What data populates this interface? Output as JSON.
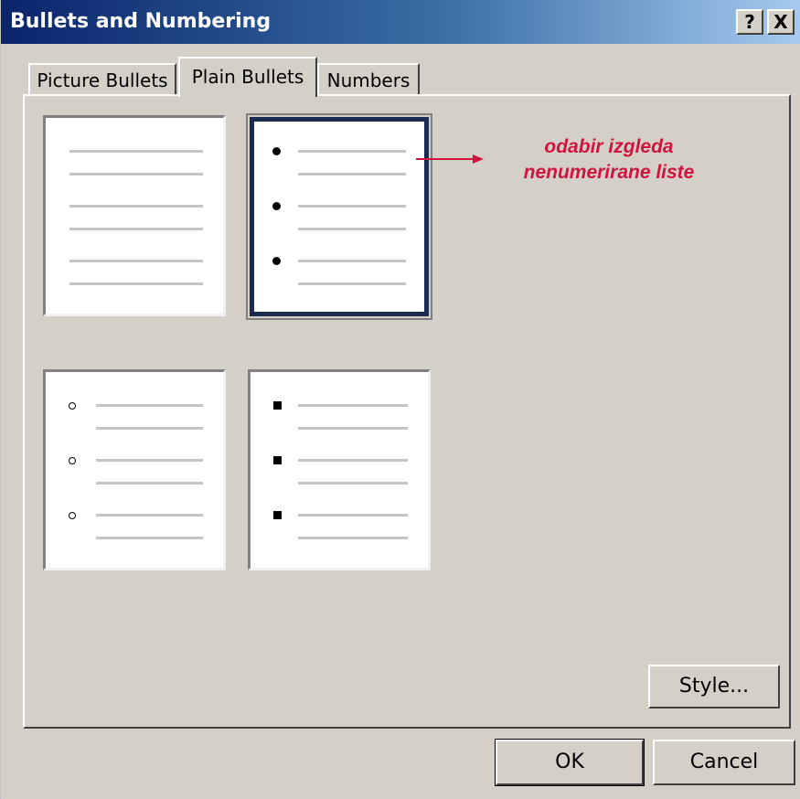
{
  "window": {
    "title": "Bullets and Numbering",
    "help_label": "?",
    "close_label": "X"
  },
  "tabs": [
    {
      "label": "Picture Bullets",
      "selected": false
    },
    {
      "label": "Plain Bullets",
      "selected": true
    },
    {
      "label": "Numbers",
      "selected": false
    }
  ],
  "options": [
    {
      "name": "none",
      "bullet": "none",
      "selected": false
    },
    {
      "name": "disc",
      "bullet": "filled-circle",
      "selected": true
    },
    {
      "name": "circle",
      "bullet": "hollow-circle",
      "selected": false
    },
    {
      "name": "square",
      "bullet": "filled-square",
      "selected": false
    }
  ],
  "annotation": {
    "line1": "odabir izgleda",
    "line2": "nenumerirane liste",
    "color": "#d2143c"
  },
  "buttons": {
    "style_label": "Style...",
    "ok_label": "OK",
    "cancel_label": "Cancel"
  }
}
